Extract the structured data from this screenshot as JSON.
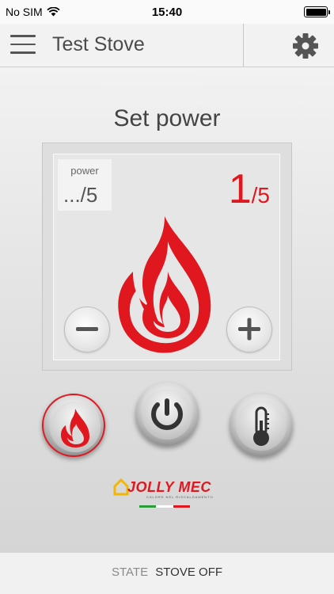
{
  "status_bar": {
    "carrier": "No SIM",
    "time": "15:40"
  },
  "header": {
    "title": "Test Stove"
  },
  "main": {
    "title": "Set power",
    "power_box": {
      "label": "power",
      "value": ".../5"
    },
    "current_level": "1",
    "max_level": "/5",
    "icons": {
      "main": "flame-icon",
      "decrease": "minus-icon",
      "increase": "plus-icon"
    }
  },
  "actions": [
    {
      "name": "flame",
      "icon": "flame-icon",
      "selected": true
    },
    {
      "name": "power",
      "icon": "power-icon",
      "selected": false
    },
    {
      "name": "temperature",
      "icon": "thermometer-icon",
      "selected": false
    }
  ],
  "logo": {
    "text": "JOLLY MEC",
    "tagline": "CALORE NEL RISCALDAMENTO"
  },
  "footer": {
    "state_label": "STATE",
    "state_value": "STOVE OFF"
  },
  "colors": {
    "accent": "#e0171f",
    "text": "#4a4a4a",
    "flag_green": "#2a9d3a",
    "flag_white": "#ffffff",
    "flag_red": "#e0171f"
  }
}
